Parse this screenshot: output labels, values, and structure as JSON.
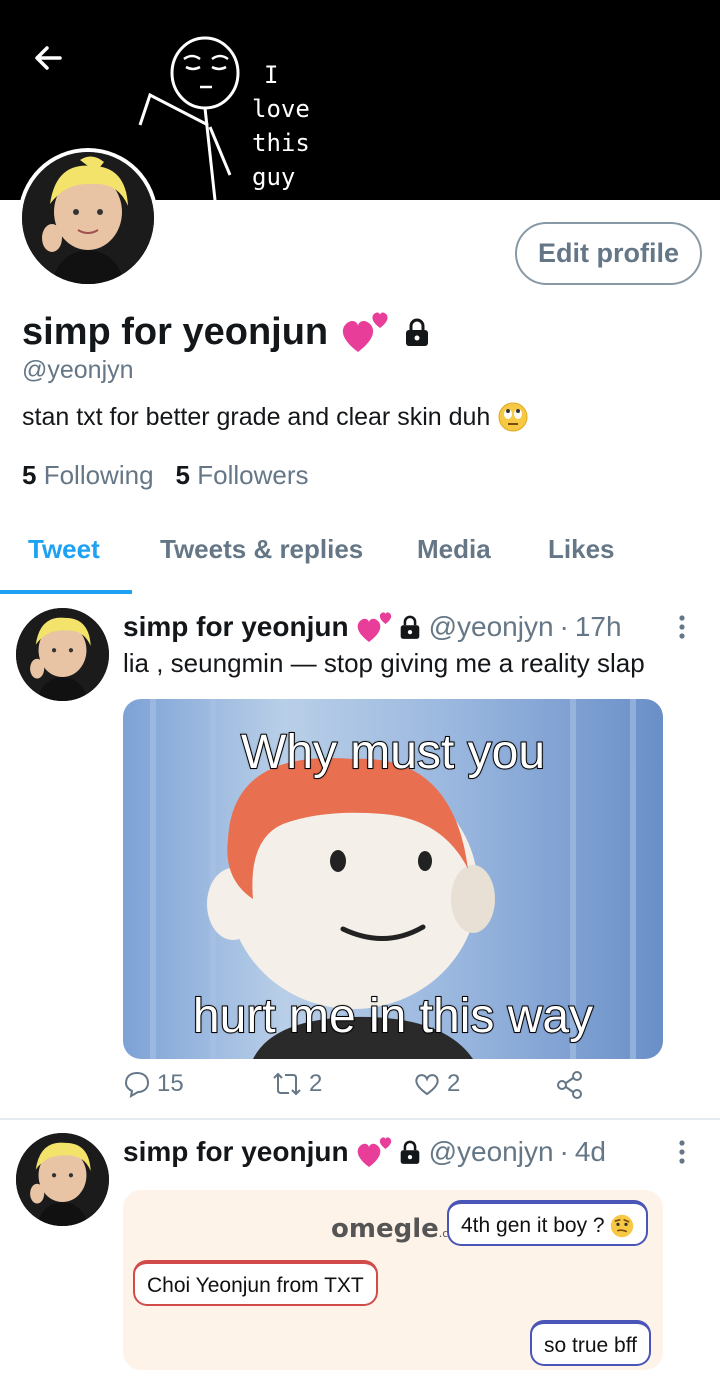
{
  "banner": {
    "handwriting_lines": [
      "I",
      "love",
      "this",
      "guy"
    ]
  },
  "profile": {
    "edit_label": "Edit profile",
    "display_name": "simp for yeonjun",
    "handle": "@yeonjyn",
    "bio": "stan txt for better grade and clear skin duh",
    "following_count": "5",
    "following_label": "Following",
    "followers_count": "5",
    "followers_label": "Followers"
  },
  "tabs": [
    {
      "label": "Tweet",
      "active": true
    },
    {
      "label": "Tweets & replies"
    },
    {
      "label": "Media"
    },
    {
      "label": "Likes"
    }
  ],
  "tweets": [
    {
      "name": "simp for yeonjun",
      "handle": "@yeonjyn",
      "time": "17h",
      "text": "lia , seungmin — stop giving me a reality slap",
      "meme_top": "Why must you",
      "meme_bottom": "hurt me in this way",
      "replies": "15",
      "retweets": "2",
      "likes": "2"
    },
    {
      "name": "simp for yeonjun",
      "handle": "@yeonjyn",
      "time": "4d",
      "omegle_logo": "omegle",
      "omegle_suffix": ".com",
      "bubble_1": "4th gen it boy ?",
      "bubble_2": "Choi Yeonjun from TXT",
      "bubble_3": "so true bff"
    }
  ],
  "colors": {
    "accent": "#1da1f2",
    "muted": "#657786",
    "text": "#14171a"
  }
}
